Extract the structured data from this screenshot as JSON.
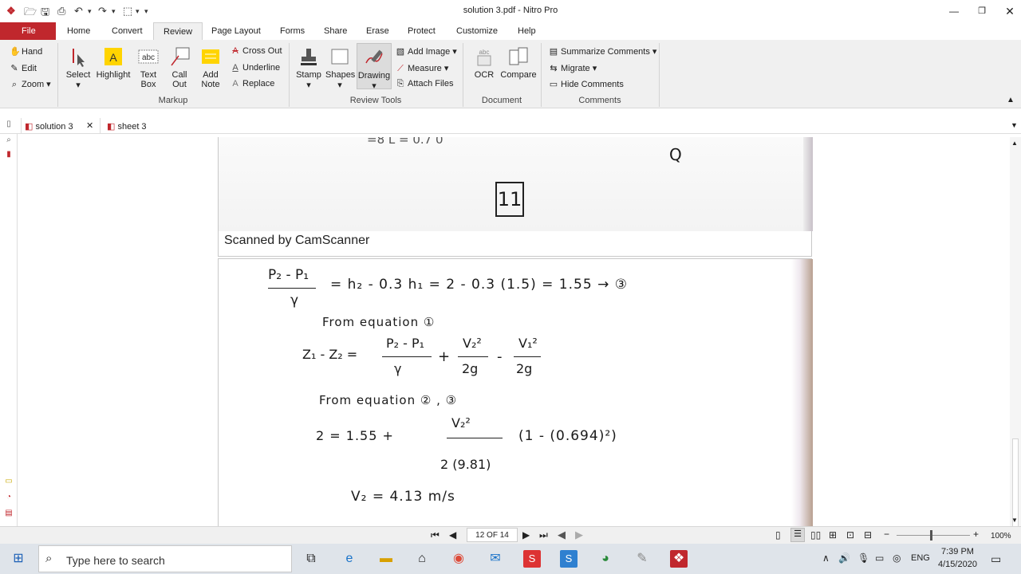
{
  "window": {
    "title": "solution 3.pdf - Nitro Pro",
    "minimize_icon": "minimize-icon",
    "restore_icon": "restore-icon",
    "close_icon": "close-icon"
  },
  "menu": {
    "file": "File",
    "tabs": [
      "Home",
      "Convert",
      "Review",
      "Page Layout",
      "Forms",
      "Share",
      "Erase",
      "Protect",
      "Customize",
      "Help"
    ],
    "active_tab": "Review"
  },
  "ribbon": {
    "nav": {
      "hand": "Hand",
      "edit": "Edit",
      "zoom": "Zoom"
    },
    "markup": {
      "select": "Select",
      "highlight": "Highlight",
      "text_box_1": "Text",
      "text_box_2": "Box",
      "call_out_1": "Call",
      "call_out_2": "Out",
      "add_note_1": "Add",
      "add_note_2": "Note",
      "cross_out": "Cross Out",
      "underline": "Underline",
      "replace": "Replace",
      "group": "Markup"
    },
    "review_tools": {
      "stamp": "Stamp",
      "shapes": "Shapes",
      "drawing": "Drawing",
      "add_image": "Add Image",
      "measure": "Measure",
      "attach_files": "Attach Files",
      "group": "Review Tools"
    },
    "document": {
      "ocr": "OCR",
      "compare": "Compare",
      "group": "Document"
    },
    "comments": {
      "summarize": "Summarize Comments",
      "migrate": "Migrate",
      "hide": "Hide Comments",
      "group": "Comments"
    }
  },
  "doc_tabs": [
    {
      "label": "solution 3",
      "active": true
    },
    {
      "label": "sheet 3",
      "active": false
    }
  ],
  "page_top": {
    "scanned_label": "Scanned by CamScanner",
    "box_number": "11",
    "partial_line": "=8 L = 0.7 0",
    "corner_mark": "Q"
  },
  "handwriting": {
    "line1_lhs_num": "P₂ - P₁",
    "line1_lhs_den": "γ",
    "line1_rhs": "= h₂ - 0.3 h₁ = 2 - 0.3 (1.5) = 1.55 → ③",
    "line2": "From equation ①",
    "line3_lhs": "Z₁ - Z₂ =",
    "line3_f1_num": "P₂ - P₁",
    "line3_f1_den": "γ",
    "line3_plus": "+",
    "line3_f2_num": "V₂²",
    "line3_f2_den": "2g",
    "line3_minus": "-",
    "line3_f3_num": "V₁²",
    "line3_f3_den": "2g",
    "line4": "From equation ② , ③",
    "line5_lhs": "2 = 1.55 +",
    "line5_num": "V₂²",
    "line5_den": "2 (9.81)",
    "line5_rhs": "(1 - (0.694)²)",
    "line6": "V₂ = 4.13  m/s"
  },
  "statusbar": {
    "page_indicator": "12 OF 14",
    "zoom": "100%"
  },
  "taskbar": {
    "search_placeholder": "Type here to search",
    "language": "ENG",
    "time": "7:39 PM",
    "date": "4/15/2020"
  }
}
